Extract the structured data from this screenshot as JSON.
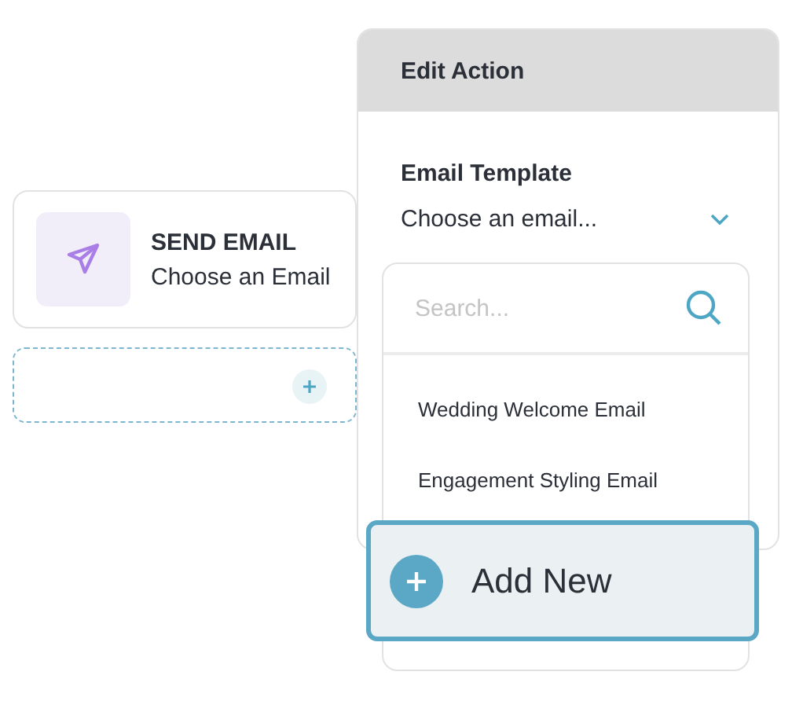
{
  "canvas": {
    "node": {
      "title": "SEND EMAIL",
      "subtitle": "Choose an Email"
    }
  },
  "panel": {
    "title": "Edit Action",
    "field_label": "Email Template",
    "select": {
      "value": "Choose an email...",
      "expanded": true
    }
  },
  "dropdown": {
    "search": {
      "placeholder": "Search..."
    },
    "options": [
      {
        "label": "Wedding Welcome Email",
        "selected": false
      },
      {
        "label": "Engagement Styling Email",
        "selected": false
      }
    ],
    "add_button": {
      "label": "Add New"
    }
  }
}
